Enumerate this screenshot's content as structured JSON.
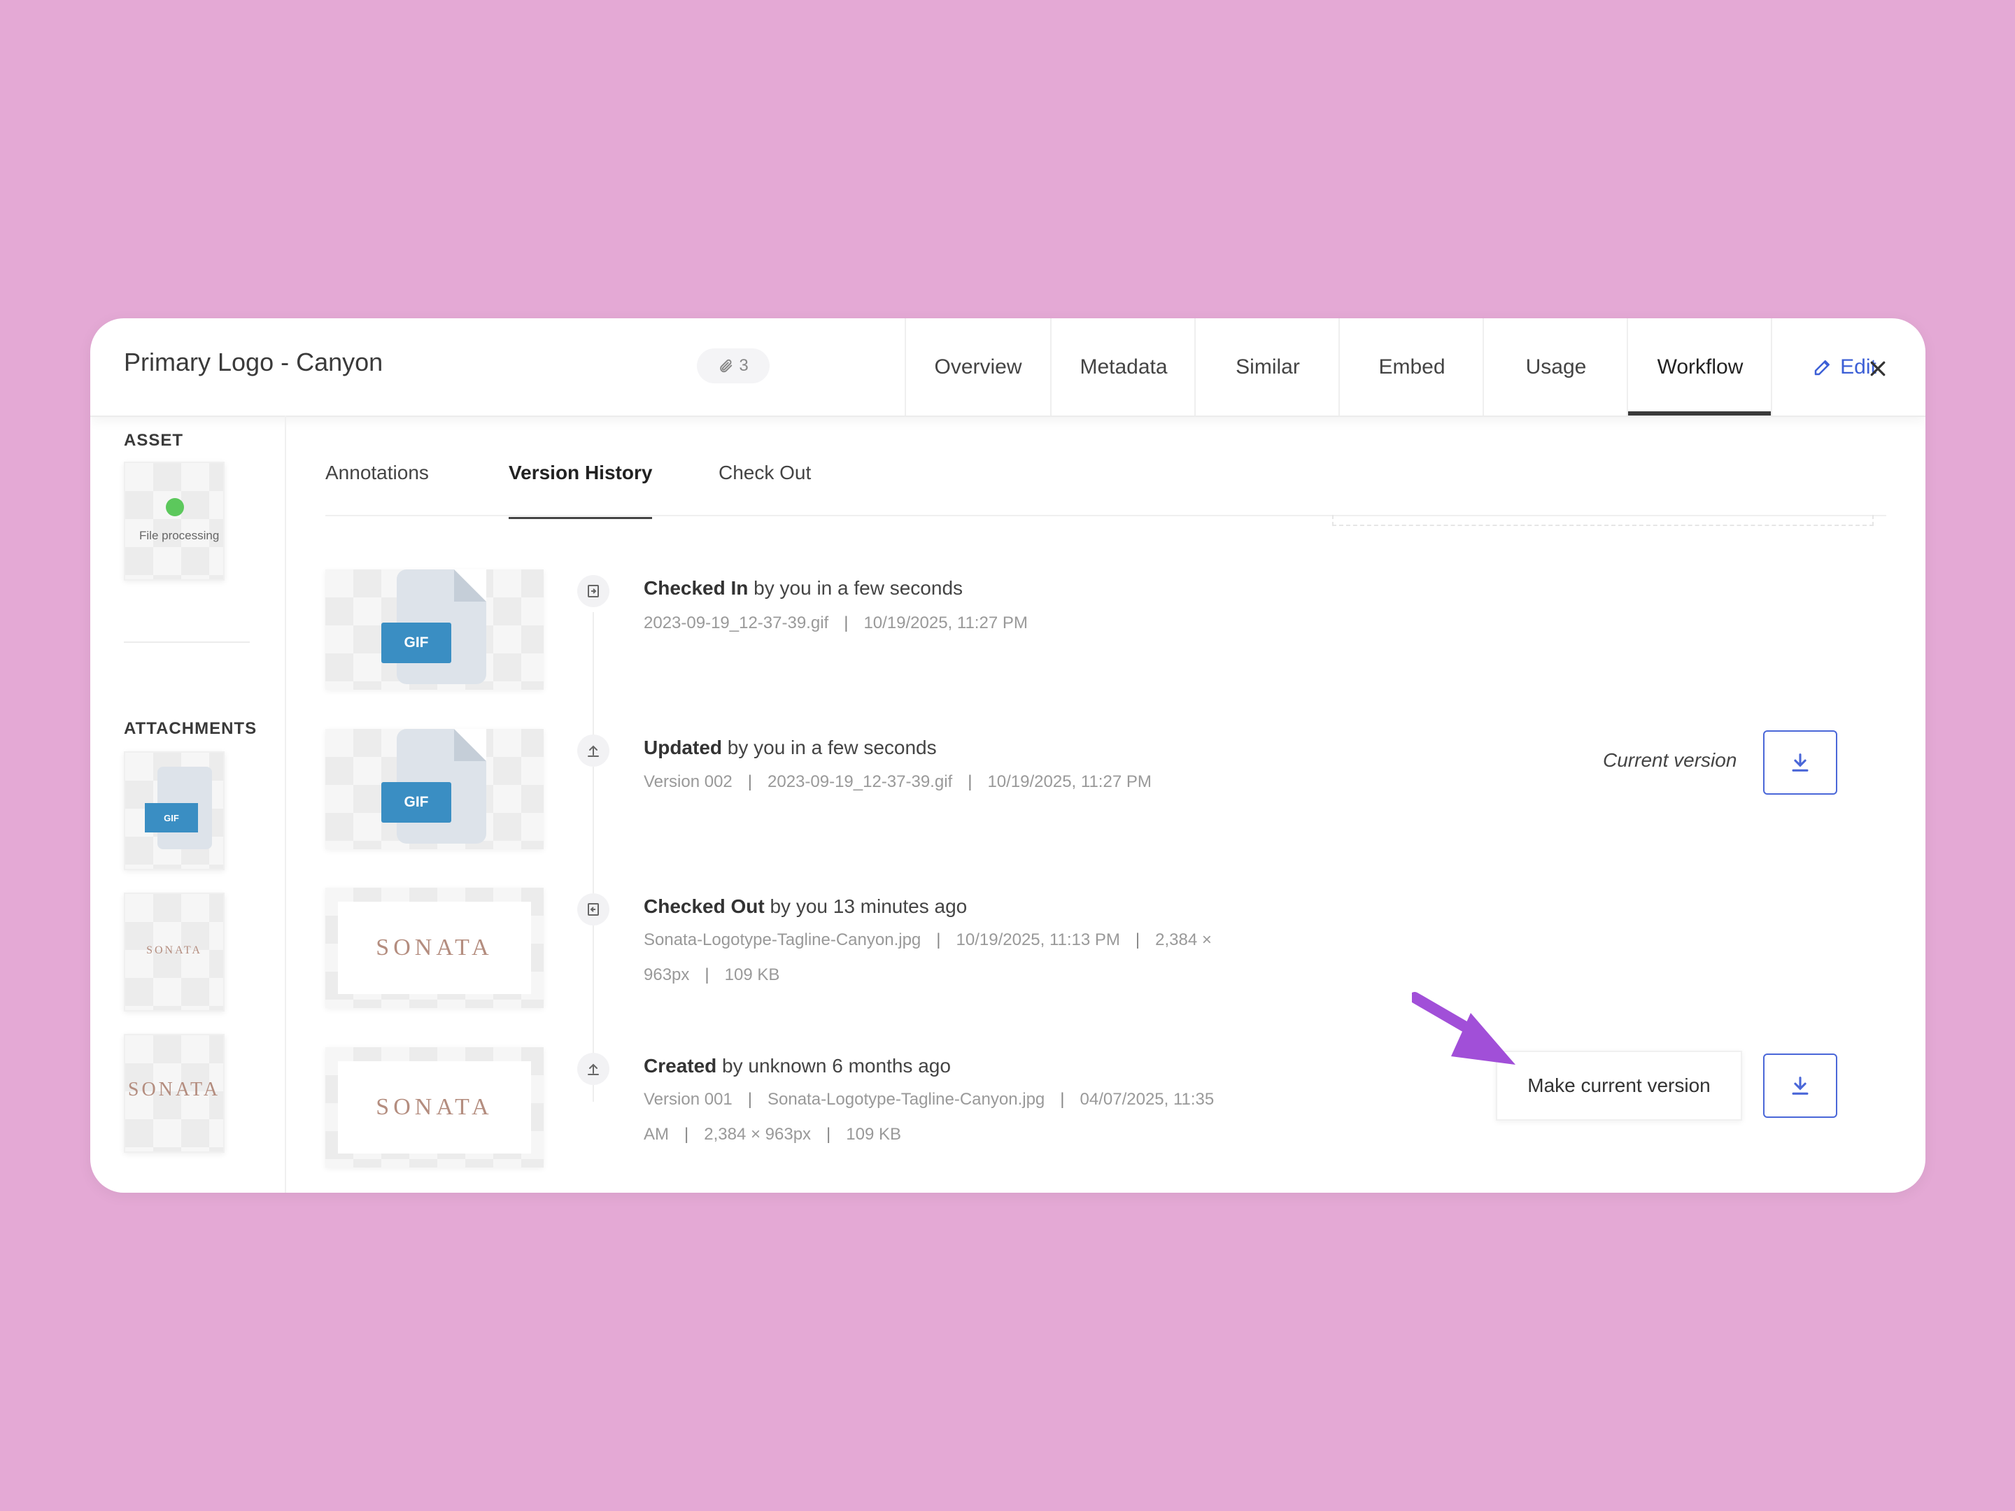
{
  "header": {
    "title": "Primary Logo - Canyon",
    "attachment_count": "3",
    "tabs": [
      {
        "label": "Overview"
      },
      {
        "label": "Metadata"
      },
      {
        "label": "Similar"
      },
      {
        "label": "Embed"
      },
      {
        "label": "Usage"
      },
      {
        "label": "Workflow"
      }
    ],
    "edit_label": "Edit",
    "active_tab": "Workflow"
  },
  "sidebar": {
    "asset_label": "ASSET",
    "asset_status": "File processing",
    "attachments_label": "ATTACHMENTS",
    "attachments": [
      {
        "type": "GIF"
      },
      {
        "brand": "SONATA"
      },
      {
        "brand": "SONATA"
      }
    ]
  },
  "subtabs": {
    "items": [
      {
        "label": "Annotations"
      },
      {
        "label": "Version History"
      },
      {
        "label": "Check Out"
      }
    ],
    "active": "Version History"
  },
  "versions": [
    {
      "action": "Checked In",
      "rest": " by you in a few seconds",
      "meta_line1": [
        "2023-09-19_12-37-39.gif",
        "10/19/2025, 11:27 PM"
      ],
      "thumb": "GIF"
    },
    {
      "action": "Updated",
      "rest": " by you in a few seconds",
      "meta_line1": [
        "Version 002",
        "2023-09-19_12-37-39.gif",
        "10/19/2025, 11:27 PM"
      ],
      "thumb": "GIF",
      "status": "Current version"
    },
    {
      "action": "Checked Out",
      "rest": " by you 13 minutes ago",
      "meta_line1": [
        "Sonata-Logotype-Tagline-Canyon.jpg",
        "10/19/2025, 11:13 PM",
        "2,384 ×"
      ],
      "meta_line2": [
        "963px",
        "109 KB"
      ],
      "thumb": "SONATA"
    },
    {
      "action": "Created",
      "rest": " by unknown 6 months ago",
      "meta_line1": [
        "Version 001",
        "Sonata-Logotype-Tagline-Canyon.jpg",
        "04/07/2025, 11:35"
      ],
      "meta_line2": [
        "AM",
        "2,384 × 963px",
        "109 KB"
      ],
      "thumb": "SONATA",
      "action_button": "Make current version"
    }
  ],
  "icons": {
    "attachment": "paperclip-icon",
    "edit": "pencil-icon",
    "close": "close-icon",
    "check_in": "check-in-icon",
    "upload": "upload-icon",
    "download": "download-icon",
    "next": "arrow-right-icon"
  },
  "colors": {
    "background": "#e4a9d5",
    "accent": "#4a67d8",
    "gif_badge": "#3a8ec3",
    "pointer_arrow": "#a14fd8",
    "processing_dot": "#5cc85c"
  }
}
